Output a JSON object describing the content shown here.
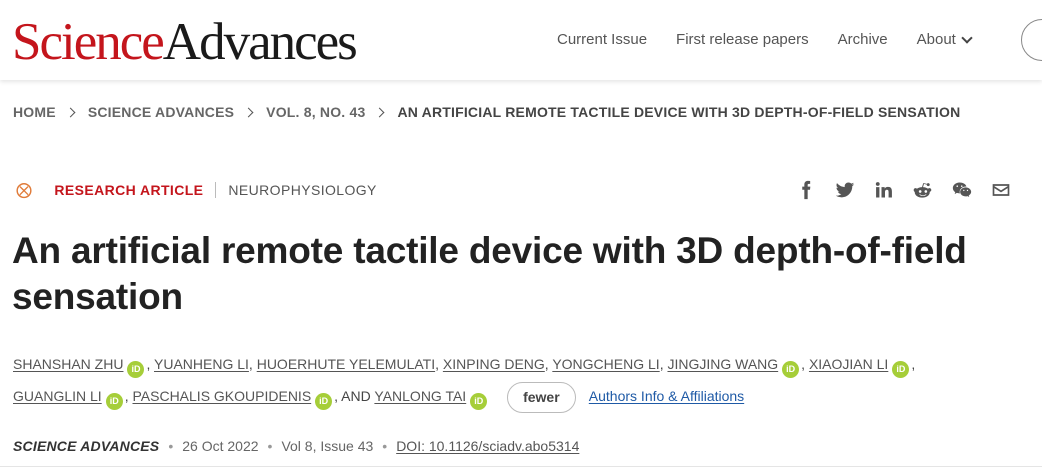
{
  "header": {
    "logo_science": "Science",
    "logo_advances": "Advances",
    "nav": [
      {
        "label": "Current Issue"
      },
      {
        "label": "First release papers"
      },
      {
        "label": "Archive"
      },
      {
        "label": "About"
      }
    ]
  },
  "breadcrumb": [
    "HOME",
    "SCIENCE ADVANCES",
    "VOL. 8, NO. 43",
    "AN ARTIFICIAL REMOTE TACTILE DEVICE WITH 3D DEPTH-OF-FIELD SENSATION"
  ],
  "article": {
    "open_access_icon": "open-access-icon",
    "type": "RESEARCH ARTICLE",
    "subject": "NEUROPHYSIOLOGY",
    "share_icons": [
      "facebook-icon",
      "twitter-icon",
      "linkedin-icon",
      "reddit-icon",
      "wechat-icon",
      "email-icon"
    ],
    "title": "An artificial remote tactile device with 3D depth-of-field sensation",
    "authors": [
      {
        "name": "SHANSHAN ZHU",
        "orcid": true
      },
      {
        "name": "YUANHENG LI",
        "orcid": false
      },
      {
        "name": "HUOERHUTE YELEMULATI",
        "orcid": false
      },
      {
        "name": "XINPING DENG",
        "orcid": false
      },
      {
        "name": "YONGCHENG LI",
        "orcid": false
      },
      {
        "name": "JINGJING WANG",
        "orcid": true
      },
      {
        "name": "XIAOJIAN LI",
        "orcid": true
      },
      {
        "name": "GUANGLIN LI",
        "orcid": true
      },
      {
        "name": "PASCHALIS GKOUPIDENIS",
        "orcid": true
      },
      {
        "name": "YANLONG TAI",
        "orcid": true
      }
    ],
    "and_text": ", AND",
    "orcid_label": "iD",
    "fewer_label": "fewer",
    "affiliations_label": "Authors Info & Affiliations",
    "journal": "SCIENCE ADVANCES",
    "date": "26 Oct 2022",
    "volume_issue": "Vol 8, Issue 43",
    "doi": "DOI: 10.1126/sciadv.abo5314"
  }
}
